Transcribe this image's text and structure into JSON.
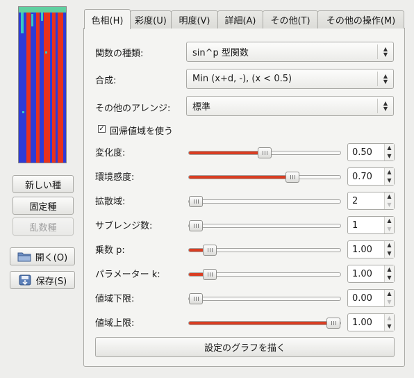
{
  "tabs": [
    {
      "label": "色相(H)"
    },
    {
      "label": "彩度(U)"
    },
    {
      "label": "明度(V)"
    },
    {
      "label": "詳細(A)"
    },
    {
      "label": "その他(T)"
    },
    {
      "label": "その他の操作(M)"
    }
  ],
  "left_panel": {
    "new_seed_label": "新しい種",
    "fixed_seed_label": "固定種",
    "random_seed_label": "乱数種",
    "open_label": "開く(O)",
    "save_label": "保存(S)"
  },
  "form": {
    "function_type_label": "関数の種類:",
    "function_type_value": "sin^p 型関数",
    "composition_label": "合成:",
    "composition_value": "Min (x+d, -), (x < 0.5)",
    "misc_arrange_label": "その他のアレンジ:",
    "misc_arrange_value": "標準",
    "use_cyclic_range_label": "回帰値域を使う",
    "use_cyclic_range_checked": true
  },
  "sliders": [
    {
      "label": "変化度:",
      "value": "0.50",
      "fraction": 0.5
    },
    {
      "label": "環境感度:",
      "value": "0.70",
      "fraction": 0.7
    },
    {
      "label": "拡散域:",
      "value": "2",
      "fraction": 0.0
    },
    {
      "label": "サブレンジ数:",
      "value": "1",
      "fraction": 0.0
    },
    {
      "label": "乗数 p:",
      "value": "1.00",
      "fraction": 0.1
    },
    {
      "label": "パラメーター k:",
      "value": "1.00",
      "fraction": 0.1
    },
    {
      "label": "値域下限:",
      "value": "0.00",
      "fraction": 0.0
    },
    {
      "label": "値域上限:",
      "value": "1.00",
      "fraction": 1.0
    }
  ],
  "draw_graph_label": "設定のグラフを描く",
  "colors": {
    "slider_fill": "#d93d22",
    "preview_blue": "#2e3bd6",
    "preview_red": "#e8321c",
    "preview_cyan": "#38c8c0"
  }
}
